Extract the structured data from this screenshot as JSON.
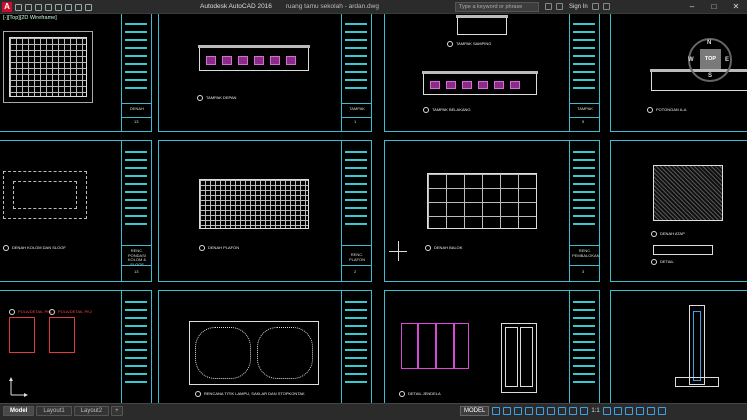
{
  "titlebar": {
    "app_title": "Autodesk AutoCAD 2016",
    "file_name": "ruang tamu sekolah - ardan.dwg",
    "search_placeholder": "Type a keyword or phrase",
    "sign_in": "Sign In",
    "minimize": "–",
    "maximize": "□",
    "close": "✕"
  },
  "viewport": {
    "label": "[-][Top][2D Wireframe]"
  },
  "viewcube": {
    "top": "TOP",
    "north": "N",
    "west": "W",
    "east": "E",
    "south": "S"
  },
  "sheets": {
    "tampak_depan": "TAMPAK DEPAN",
    "tampak_depan_tb": "TAMPAK",
    "tampak_samping": "TAMPAK SAMPING",
    "tampak_belakang": "TAMPAK BELAKANG",
    "tampak_tb": "TAMPAK",
    "potongan": "POTONGAN A-A",
    "denah": "DENAH",
    "denah_tb": "DENAH",
    "kolom": "DENAH KOLOM DAN SLOOF",
    "kolom_tb": "RENC. PONDASI KOLOM & SLOOF",
    "plafon": "DENAH PLAFON",
    "plafon_tb": "RENC. PLAFON",
    "balok": "DENAH BALOK",
    "balok_tb": "RENC. PEMBALOKAN",
    "atap": "DENAH ATAP",
    "detail": "DETAIL",
    "lampu": "RENCANA TITIK LAMPU, SAKLAR DAN STOPKONTAK",
    "jendela": "DETAIL JENDELA",
    "kusen_p1": "POLA/DETAIL PK1",
    "kusen_p2": "POLA/DETAIL PK2",
    "sheet_nums": [
      "13",
      "1",
      "5",
      "6",
      "7",
      "8",
      "13",
      "2",
      "3",
      "10",
      "11",
      "4"
    ]
  },
  "statusbar": {
    "tabs": [
      "Model",
      "Layout1",
      "Layout2"
    ],
    "add_tab": "+",
    "model_button": "MODEL",
    "scale": "1:1"
  }
}
